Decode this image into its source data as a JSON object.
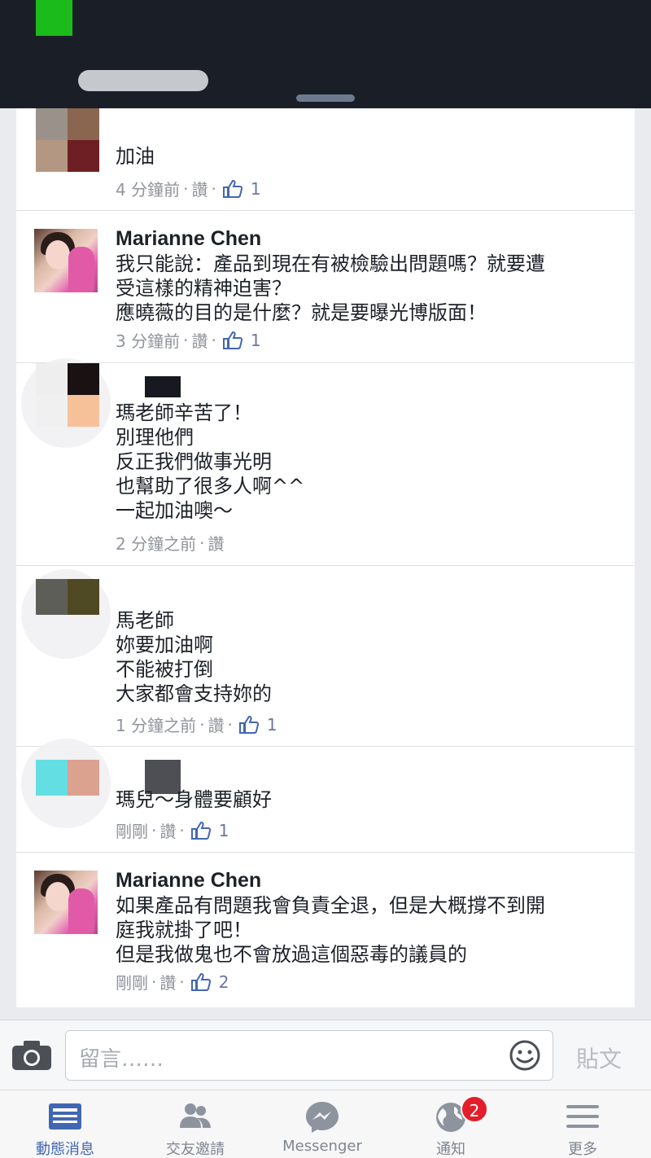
{
  "feed": {
    "comments": [
      {
        "author": "",
        "text": "加油",
        "time": "4 分鐘前",
        "like_label": "讚",
        "like_count": "1"
      },
      {
        "author": "Marianne Chen",
        "text": "我只能說：產品到現在有被檢驗出問題嗎？就要遭\n受這樣的精神迫害？\n應曉薇的目的是什麼？就是要曝光博版面！",
        "time": "3 分鐘前",
        "like_label": "讚",
        "like_count": "1"
      },
      {
        "author": "",
        "text": "瑪老師辛苦了！\n別理他們\n反正我們做事光明\n也幫助了很多人啊^^\n一起加油噢～",
        "time": "2 分鐘之前",
        "like_label": "讚"
      },
      {
        "author": "",
        "text": "馬老師\n妳要加油啊\n不能被打倒\n大家都會支持妳的",
        "time": "1 分鐘之前",
        "like_label": "讚",
        "like_count": "1"
      },
      {
        "author": "",
        "text": "瑪兒～身體要顧好",
        "time": "剛剛",
        "like_label": "讚",
        "like_count": "1"
      },
      {
        "author": "Marianne Chen",
        "text": "如果產品有問題我會負責全退，但是大概撐不到開\n庭我就掛了吧！\n但是我做鬼也不會放過這個惡毒的議員的",
        "time": "剛剛",
        "like_label": "讚",
        "like_count": "2"
      }
    ]
  },
  "composer": {
    "placeholder": "留言……",
    "post_label": "貼文",
    "camera_icon": "camera-icon",
    "emoji_icon": "emoji-icon"
  },
  "tabbar": {
    "tabs": [
      {
        "label": "動態消息",
        "icon": "news-feed-icon",
        "active": true
      },
      {
        "label": "交友邀請",
        "icon": "friend-requests-icon"
      },
      {
        "label": "Messenger",
        "icon": "messenger-icon"
      },
      {
        "label": "通知",
        "icon": "globe-icon",
        "badge": "2"
      },
      {
        "label": "更多",
        "icon": "menu-icon"
      }
    ]
  },
  "colors": {
    "accent": "#4267b2",
    "badge": "#e41d2a",
    "meta_text": "#90949c"
  }
}
